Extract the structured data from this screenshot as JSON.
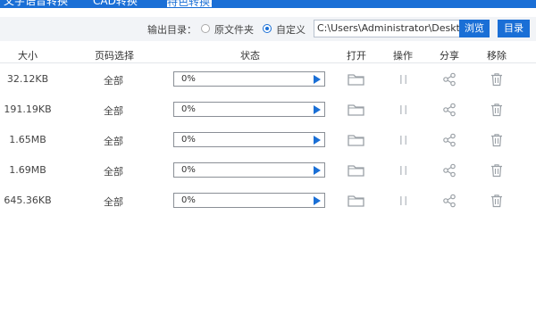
{
  "tabs": [
    {
      "label": "文字语音转换"
    },
    {
      "label": "CAD转换"
    },
    {
      "label": "特色转换",
      "caret": "⏶"
    }
  ],
  "output": {
    "label": "输出目录：",
    "option_original": "原文件夹",
    "option_custom": "自定义",
    "selected": "自定义",
    "path": "C:\\Users\\Administrator\\Desktop",
    "browse_label": "浏览",
    "dir_label": "目录"
  },
  "columns": {
    "size": "大小",
    "pages": "页码选择",
    "status": "状态",
    "open": "打开",
    "action": "操作",
    "share": "分享",
    "remove": "移除"
  },
  "rows": [
    {
      "size": "32.12KB",
      "pages": "全部",
      "progress": "0%"
    },
    {
      "size": "191.19KB",
      "pages": "全部",
      "progress": "0%"
    },
    {
      "size": "1.65MB",
      "pages": "全部",
      "progress": "0%"
    },
    {
      "size": "1.69MB",
      "pages": "全部",
      "progress": "0%"
    },
    {
      "size": "645.36KB",
      "pages": "全部",
      "progress": "0%"
    }
  ],
  "colors": {
    "accent": "#1a6fd6",
    "icon_grey": "#9aa0a6"
  },
  "icons": [
    "folder-icon",
    "pause-icon",
    "share-icon",
    "trash-icon",
    "play-icon"
  ]
}
